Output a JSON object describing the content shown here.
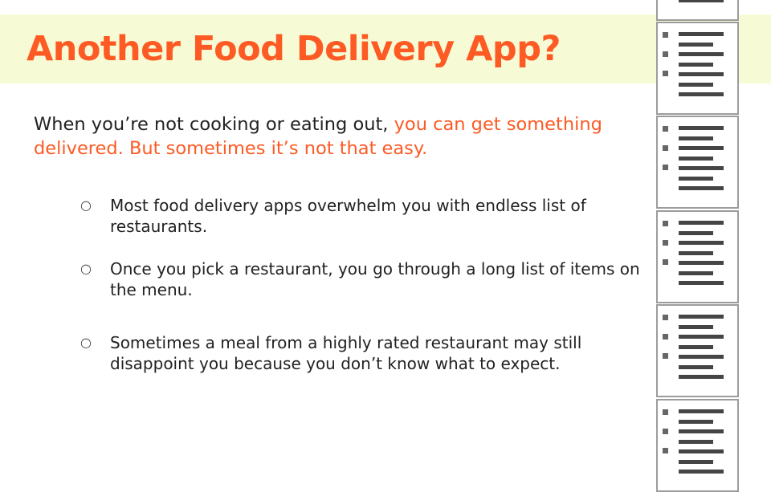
{
  "slide": {
    "title": "Another Food Delivery App?",
    "intro": {
      "plain": "When you’re not cooking or eating out, ",
      "highlight": "you can get something delivered. But sometimes it’s not that easy."
    },
    "bullet_marker": "○",
    "bullets": [
      "Most food delivery apps overwhelm you with endless list of restaurants.",
      "Once you pick a restaurant, you go through a long list of items on the menu.",
      "Sometimes a meal from a highly rated restaurant may still disappoint you because you don’t know what to expect."
    ]
  },
  "colors": {
    "accent": "#fd5a24",
    "title_band": "#f6fbd6",
    "body_text": "#222222",
    "card_border": "#9c9c9c"
  },
  "icons": [
    "document-page-icon",
    "hollow-circle-bullet-icon"
  ]
}
